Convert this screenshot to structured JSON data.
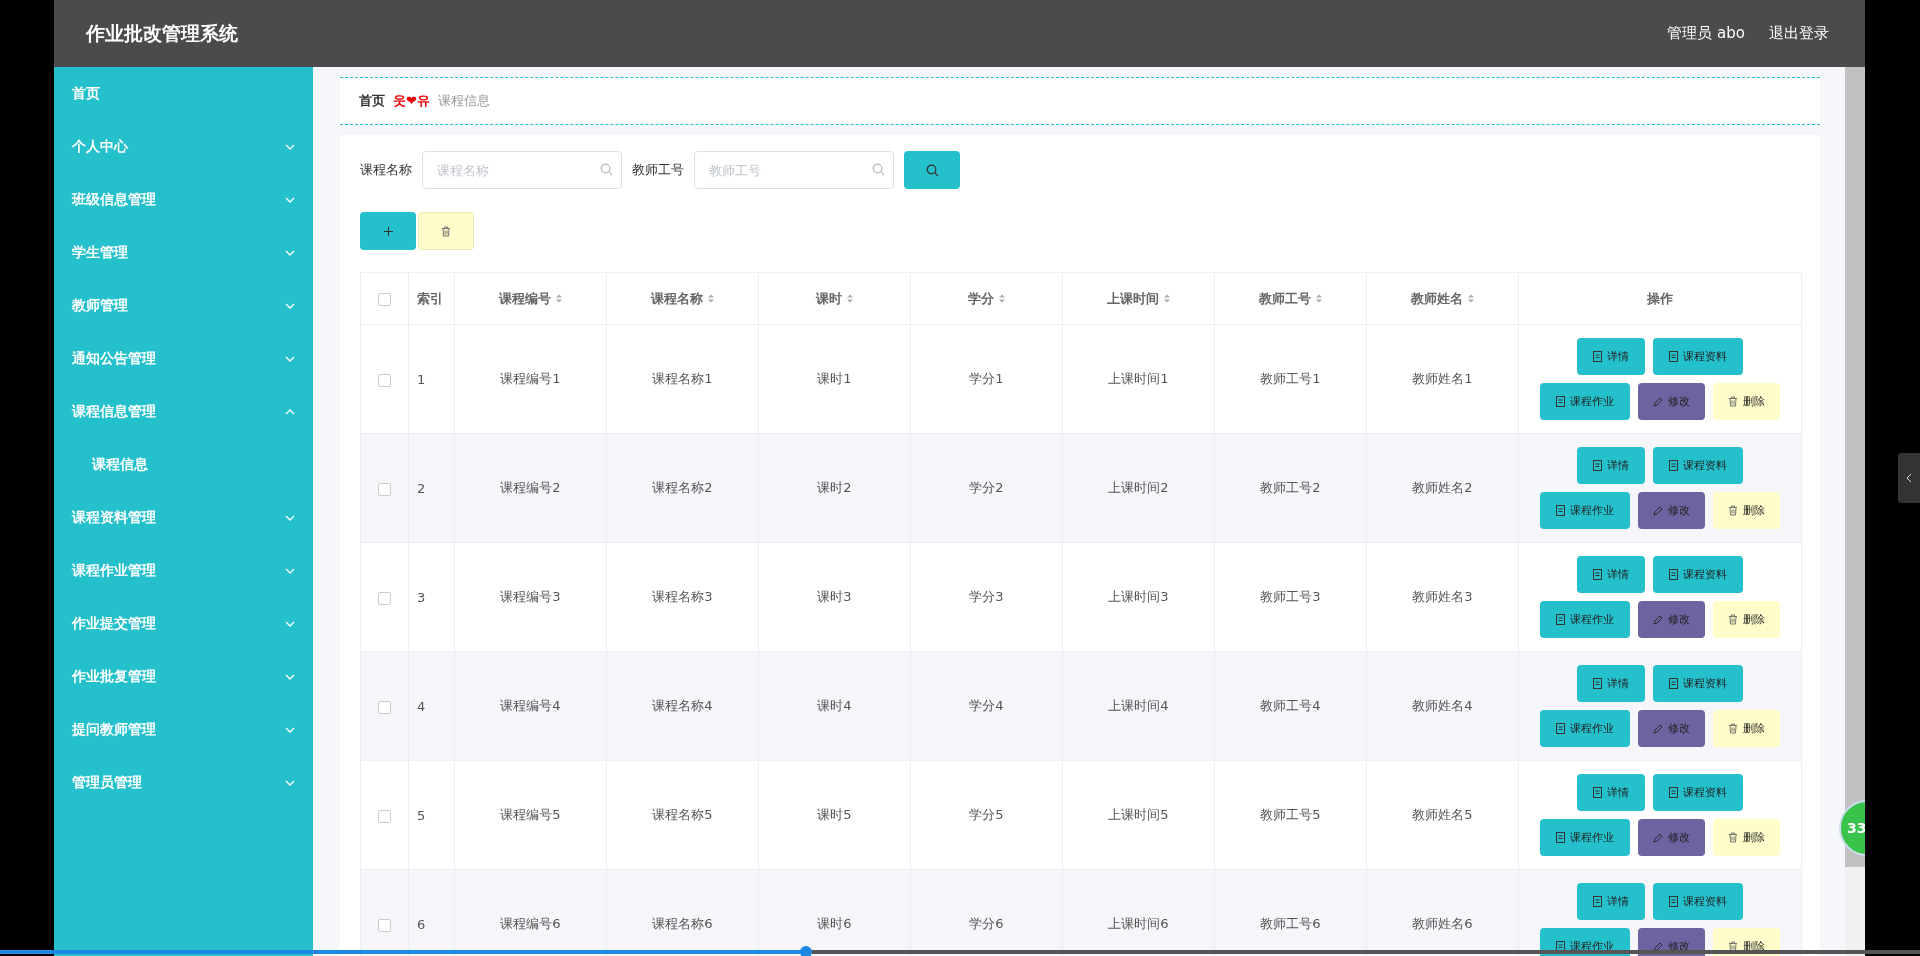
{
  "header": {
    "title": "作业批改管理系统",
    "user": "管理员 abo",
    "logout": "退出登录"
  },
  "sidebar": {
    "items": [
      {
        "label": "首页",
        "kind": "link"
      },
      {
        "label": "个人中心",
        "kind": "menu",
        "expanded": false
      },
      {
        "label": "班级信息管理",
        "kind": "menu",
        "expanded": false
      },
      {
        "label": "学生管理",
        "kind": "menu",
        "expanded": false
      },
      {
        "label": "教师管理",
        "kind": "menu",
        "expanded": false
      },
      {
        "label": "通知公告管理",
        "kind": "menu",
        "expanded": false
      },
      {
        "label": "课程信息管理",
        "kind": "menu",
        "expanded": true,
        "children": [
          {
            "label": "课程信息"
          }
        ]
      },
      {
        "label": "课程资料管理",
        "kind": "menu",
        "expanded": false
      },
      {
        "label": "课程作业管理",
        "kind": "menu",
        "expanded": false
      },
      {
        "label": "作业提交管理",
        "kind": "menu",
        "expanded": false
      },
      {
        "label": "作业批复管理",
        "kind": "menu",
        "expanded": false
      },
      {
        "label": "提问教师管理",
        "kind": "menu",
        "expanded": false
      },
      {
        "label": "管理员管理",
        "kind": "menu",
        "expanded": false
      }
    ]
  },
  "breadcrumb": {
    "home": "首页",
    "separator": "웃❤유",
    "current": "课程信息"
  },
  "search": {
    "fields": [
      {
        "label": "课程名称",
        "placeholder": "课程名称"
      },
      {
        "label": "教师工号",
        "placeholder": "教师工号"
      }
    ]
  },
  "table": {
    "all_checked": false,
    "columns": [
      {
        "label": "索引",
        "sortable": false
      },
      {
        "label": "课程编号",
        "sortable": true
      },
      {
        "label": "课程名称",
        "sortable": true
      },
      {
        "label": "课时",
        "sortable": true
      },
      {
        "label": "学分",
        "sortable": true
      },
      {
        "label": "上课时间",
        "sortable": true
      },
      {
        "label": "教师工号",
        "sortable": true
      },
      {
        "label": "教师姓名",
        "sortable": true
      },
      {
        "label": "操作",
        "sortable": false
      }
    ],
    "rows": [
      {
        "checked": false,
        "cells": [
          "1",
          "课程编号1",
          "课程名称1",
          "课时1",
          "学分1",
          "上课时间1",
          "教师工号1",
          "教师姓名1"
        ],
        "actions": [
          {
            "kind": "detail",
            "label": "详情"
          },
          {
            "kind": "material",
            "label": "课程资料"
          },
          {
            "kind": "homework",
            "label": "课程作业"
          },
          {
            "kind": "edit",
            "label": "修改"
          },
          {
            "kind": "delete",
            "label": "删除"
          }
        ]
      },
      {
        "checked": false,
        "cells": [
          "2",
          "课程编号2",
          "课程名称2",
          "课时2",
          "学分2",
          "上课时间2",
          "教师工号2",
          "教师姓名2"
        ],
        "actions": [
          {
            "kind": "detail",
            "label": "详情"
          },
          {
            "kind": "material",
            "label": "课程资料"
          },
          {
            "kind": "homework",
            "label": "课程作业"
          },
          {
            "kind": "edit",
            "label": "修改"
          },
          {
            "kind": "delete",
            "label": "删除"
          }
        ]
      },
      {
        "checked": false,
        "cells": [
          "3",
          "课程编号3",
          "课程名称3",
          "课时3",
          "学分3",
          "上课时间3",
          "教师工号3",
          "教师姓名3"
        ],
        "actions": [
          {
            "kind": "detail",
            "label": "详情"
          },
          {
            "kind": "material",
            "label": "课程资料"
          },
          {
            "kind": "homework",
            "label": "课程作业"
          },
          {
            "kind": "edit",
            "label": "修改"
          },
          {
            "kind": "delete",
            "label": "删除"
          }
        ]
      },
      {
        "checked": false,
        "cells": [
          "4",
          "课程编号4",
          "课程名称4",
          "课时4",
          "学分4",
          "上课时间4",
          "教师工号4",
          "教师姓名4"
        ],
        "actions": [
          {
            "kind": "detail",
            "label": "详情"
          },
          {
            "kind": "material",
            "label": "课程资料"
          },
          {
            "kind": "homework",
            "label": "课程作业"
          },
          {
            "kind": "edit",
            "label": "修改"
          },
          {
            "kind": "delete",
            "label": "删除"
          }
        ]
      },
      {
        "checked": false,
        "cells": [
          "5",
          "课程编号5",
          "课程名称5",
          "课时5",
          "学分5",
          "上课时间5",
          "教师工号5",
          "教师姓名5"
        ],
        "actions": [
          {
            "kind": "detail",
            "label": "详情"
          },
          {
            "kind": "material",
            "label": "课程资料"
          },
          {
            "kind": "homework",
            "label": "课程作业"
          },
          {
            "kind": "edit",
            "label": "修改"
          },
          {
            "kind": "delete",
            "label": "删除"
          }
        ]
      },
      {
        "checked": false,
        "cells": [
          "6",
          "课程编号6",
          "课程名称6",
          "课时6",
          "学分6",
          "上课时间6",
          "教师工号6",
          "教师姓名6"
        ],
        "actions": [
          {
            "kind": "detail",
            "label": "详情"
          },
          {
            "kind": "material",
            "label": "课程资料"
          },
          {
            "kind": "homework",
            "label": "课程作业"
          },
          {
            "kind": "edit",
            "label": "修改"
          },
          {
            "kind": "delete",
            "label": "删除"
          }
        ]
      }
    ]
  },
  "float_badge": {
    "text": "33"
  },
  "player": {
    "level": 0.42
  }
}
